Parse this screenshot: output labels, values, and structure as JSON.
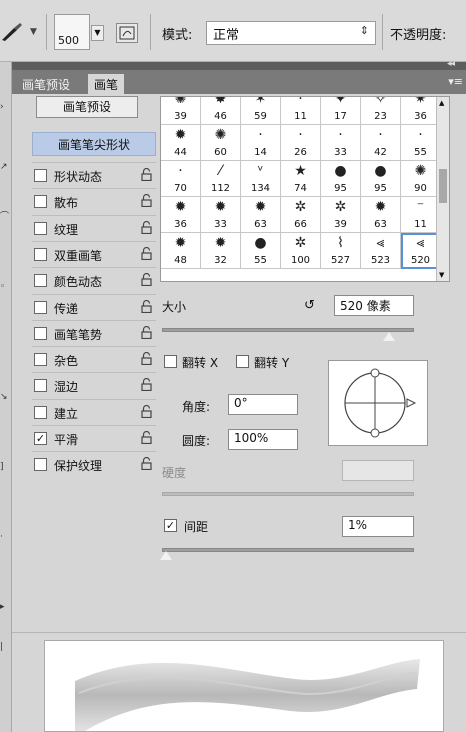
{
  "options_bar": {
    "brush_icon": "brush-tool-icon",
    "size_value": "500",
    "mode_label": "模式:",
    "mode_value": "正常",
    "opacity_label": "不透明度:"
  },
  "panel": {
    "tabs": [
      {
        "label": "画笔预设",
        "active": false
      },
      {
        "label": "画笔",
        "active": true
      }
    ],
    "presets_button": "画笔预设",
    "tip_shape_label": "画笔笔尖形状",
    "options": [
      {
        "label": "形状动态",
        "checked": false
      },
      {
        "label": "散布",
        "checked": false
      },
      {
        "label": "纹理",
        "checked": false
      },
      {
        "label": "双重画笔",
        "checked": false
      },
      {
        "label": "颜色动态",
        "checked": false
      },
      {
        "label": "传递",
        "checked": false
      },
      {
        "label": "画笔笔势",
        "checked": false
      },
      {
        "label": "杂色",
        "checked": false
      },
      {
        "label": "湿边",
        "checked": false
      },
      {
        "label": "建立",
        "checked": false
      },
      {
        "label": "平滑",
        "checked": true
      },
      {
        "label": "保护纹理",
        "checked": false
      }
    ],
    "brushes": [
      {
        "size": "39",
        "glyph": "✺"
      },
      {
        "size": "46",
        "glyph": "✸"
      },
      {
        "size": "59",
        "glyph": "✶"
      },
      {
        "size": "11",
        "glyph": "·"
      },
      {
        "size": "17",
        "glyph": "✦"
      },
      {
        "size": "23",
        "glyph": "✧"
      },
      {
        "size": "36",
        "glyph": "✷"
      },
      {
        "size": "44",
        "glyph": "✹"
      },
      {
        "size": "60",
        "glyph": "✺"
      },
      {
        "size": "14",
        "glyph": "·"
      },
      {
        "size": "26",
        "glyph": "·"
      },
      {
        "size": "33",
        "glyph": "·"
      },
      {
        "size": "42",
        "glyph": "·"
      },
      {
        "size": "55",
        "glyph": "·"
      },
      {
        "size": "70",
        "glyph": "·"
      },
      {
        "size": "112",
        "glyph": "⁄"
      },
      {
        "size": "134",
        "glyph": "ᵛ"
      },
      {
        "size": "74",
        "glyph": "★"
      },
      {
        "size": "95",
        "glyph": "●"
      },
      {
        "size": "95",
        "glyph": "●"
      },
      {
        "size": "90",
        "glyph": "✺"
      },
      {
        "size": "36",
        "glyph": "✹"
      },
      {
        "size": "33",
        "glyph": "✹"
      },
      {
        "size": "63",
        "glyph": "✹"
      },
      {
        "size": "66",
        "glyph": "✲"
      },
      {
        "size": "39",
        "glyph": "✲"
      },
      {
        "size": "63",
        "glyph": "✹"
      },
      {
        "size": "11",
        "glyph": "⁻"
      },
      {
        "size": "48",
        "glyph": "✹"
      },
      {
        "size": "32",
        "glyph": "✹"
      },
      {
        "size": "55",
        "glyph": "●"
      },
      {
        "size": "100",
        "glyph": "✲"
      },
      {
        "size": "527",
        "glyph": "⌇"
      },
      {
        "size": "523",
        "glyph": "⪡"
      },
      {
        "size": "520",
        "glyph": "⪡"
      }
    ],
    "selected_brush_index": 34,
    "size_label": "大小",
    "size_value": "520 像素",
    "flip_x_label": "翻转 X",
    "flip_y_label": "翻转 Y",
    "angle_label": "角度:",
    "angle_value": "0°",
    "roundness_label": "圆度:",
    "roundness_value": "100%",
    "hardness_label": "硬度",
    "spacing_label": "间距",
    "spacing_checked": true,
    "spacing_value": "1%",
    "size_slider_fraction": 0.9,
    "spacing_slider_fraction": 0.0
  }
}
